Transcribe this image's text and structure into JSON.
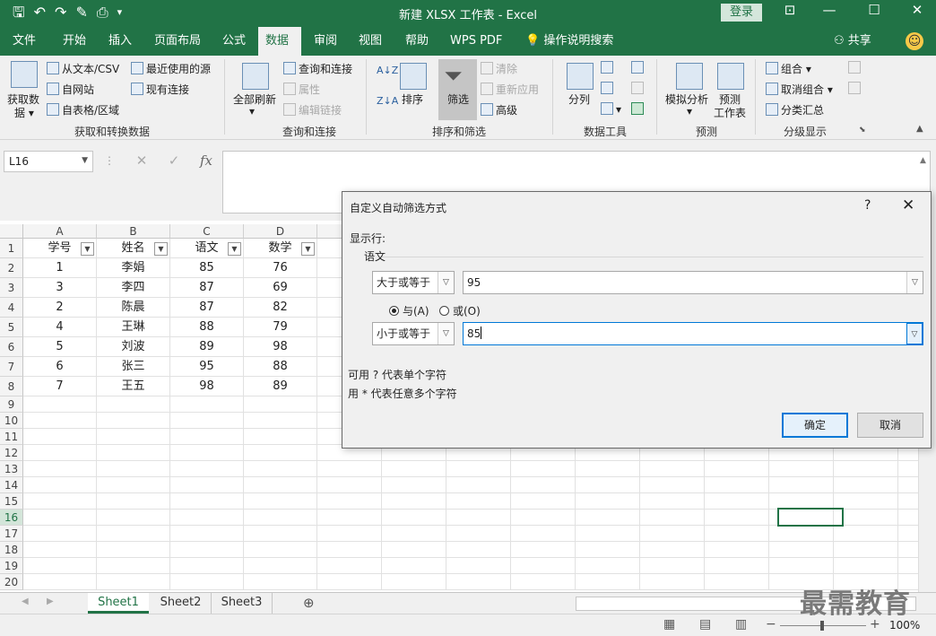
{
  "app": {
    "title": "新建 XLSX 工作表 - Excel",
    "login": "登录",
    "share": "共享",
    "colors": {
      "accent": "#217346",
      "dialog_focus": "#0078d7"
    }
  },
  "tabs": [
    "文件",
    "开始",
    "插入",
    "页面布局",
    "公式",
    "数据",
    "审阅",
    "视图",
    "帮助",
    "WPS PDF",
    "操作说明搜索"
  ],
  "active_tab": "数据",
  "ribbon": {
    "get_data": {
      "big_label_1": "获取数",
      "big_label_2": "据",
      "from_text": "从文本/CSV",
      "from_web": "自网站",
      "from_table": "自表格/区域",
      "recent": "最近使用的源",
      "existing": "现有连接",
      "group": "获取和转换数据"
    },
    "queries": {
      "refresh_all": "全部刷新",
      "query_conn": "查询和连接",
      "properties": "属性",
      "edit_links": "编辑链接",
      "group": "查询和连接"
    },
    "sort_filter": {
      "sort": "排序",
      "filter": "筛选",
      "clear": "清除",
      "reapply": "重新应用",
      "advanced": "高级",
      "group": "排序和筛选"
    },
    "data_tools": {
      "split": "分列",
      "group": "数据工具"
    },
    "forecast": {
      "whatif": "模拟分析",
      "sheet_1": "预测",
      "sheet_2": "工作表",
      "group": "预测"
    },
    "outline": {
      "group_btn": "组合",
      "ungroup": "取消组合",
      "subtotal": "分类汇总",
      "group": "分级显示"
    }
  },
  "formula_bar": {
    "name_box": "L16",
    "fx": "fx",
    "value": ""
  },
  "grid": {
    "columns": [
      "A",
      "B",
      "C",
      "D"
    ],
    "headers": [
      "学号",
      "姓名",
      "语文",
      "数学"
    ],
    "rows": [
      [
        "1",
        "李娟",
        "85",
        "76"
      ],
      [
        "3",
        "李四",
        "87",
        "69"
      ],
      [
        "2",
        "陈晨",
        "87",
        "82"
      ],
      [
        "4",
        "王琳",
        "88",
        "79"
      ],
      [
        "5",
        "刘波",
        "89",
        "98"
      ],
      [
        "6",
        "张三",
        "95",
        "88"
      ],
      [
        "7",
        "王五",
        "98",
        "89"
      ]
    ],
    "row_numbers": [
      "1",
      "2",
      "3",
      "4",
      "5",
      "6",
      "7",
      "8",
      "9",
      "10",
      "11",
      "12",
      "13",
      "14",
      "15",
      "16",
      "17",
      "18",
      "19",
      "20"
    ],
    "selected_row": "16"
  },
  "sheets": [
    "Sheet1",
    "Sheet2",
    "Sheet3"
  ],
  "active_sheet": "Sheet1",
  "status": {
    "zoom": "100%"
  },
  "watermark": "最需教育",
  "dialog": {
    "title": "自定义自动筛选方式",
    "help": "?",
    "show_rows": "显示行:",
    "field": "语文",
    "cond1_op": "大于或等于",
    "cond1_value": "95",
    "and_label": "与(A)",
    "or_label": "或(O)",
    "cond2_op": "小于或等于",
    "cond2_value": "85",
    "hint1": "可用 ? 代表单个字符",
    "hint2": "用 * 代表任意多个字符",
    "ok": "确定",
    "cancel": "取消"
  }
}
